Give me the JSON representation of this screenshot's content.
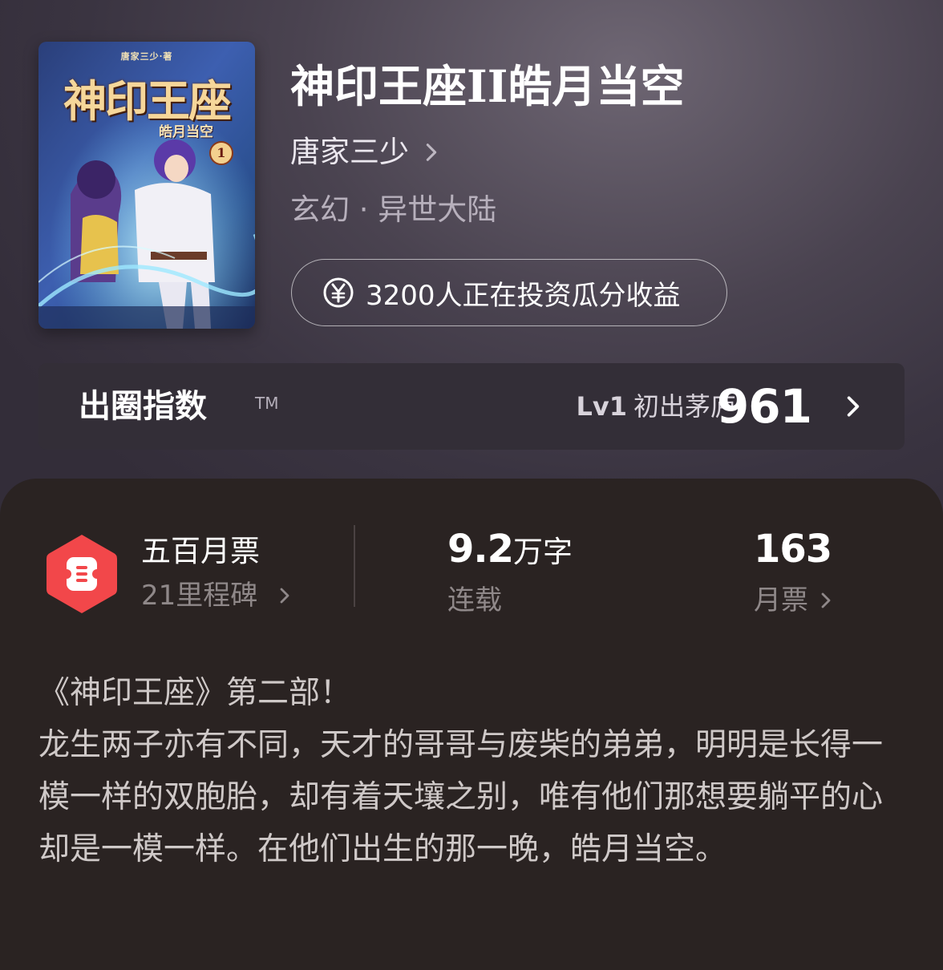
{
  "book": {
    "cover_series_text": "唐家三少·著",
    "cover_title": "神印王座",
    "cover_subtitle": "皓月当空",
    "cover_volume": "1",
    "title": "神印王座II皓月当空",
    "author": "唐家三少",
    "genre": "玄幻 · 异世大陆",
    "invest_text": "3200人正在投资瓜分收益",
    "invest_icon": "yen-coin-icon"
  },
  "index_bar": {
    "title": "出圈指数",
    "trademark": "TM",
    "level": "Lv1",
    "level_name": "初出茅庐",
    "score": "961"
  },
  "stats": {
    "ticket_title": "五百月票",
    "milestone": "21里程碑",
    "word_count_num": "9.2",
    "word_count_unit": "万字",
    "status": "连载",
    "monthly_votes": "163",
    "monthly_votes_label": "月票"
  },
  "intro": {
    "lines": [
      "《神印王座》第二部！",
      "龙生两子亦有不同，天才的哥哥与废柴的弟弟，明明是长得一模一样的双胞胎，却有着天壤之别，唯有他们那想要躺平的心却是一模一样。在他们出生的那一晚，皓月当空。"
    ]
  },
  "colors": {
    "badge_red": "#f2474a",
    "panel_bg": "#2a2322",
    "index_bar_bg": "#332e37"
  }
}
